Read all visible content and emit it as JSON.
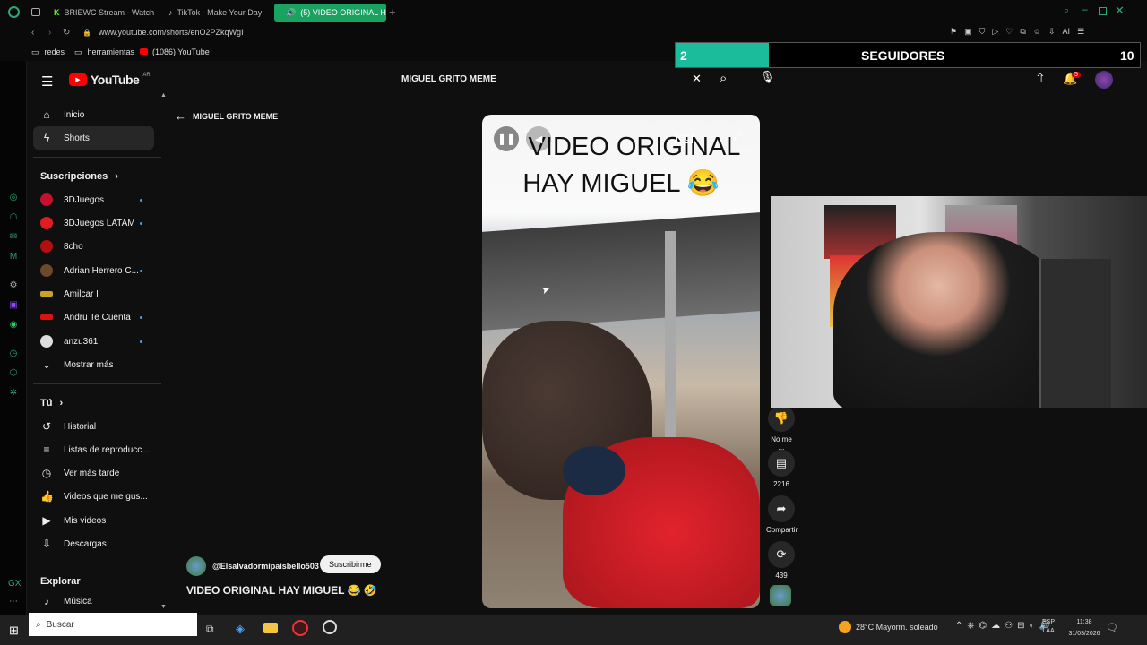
{
  "browser": {
    "tabs": [
      {
        "label": "BRIEWC Stream - Watch L"
      },
      {
        "label": "TikTok - Make Your Day"
      },
      {
        "label": "(5) VIDEO ORIGINAL H"
      }
    ],
    "url": "www.youtube.com/shorts/enO2PZkqWgI",
    "bookmarks": [
      "redes",
      "herramientas",
      "(1086) YouTube"
    ],
    "ai_label": "AI"
  },
  "youtube": {
    "logo_text": "YouTube",
    "country": "AR",
    "search_value": "MIGUEL GRITO MEME",
    "back_label": "MIGUEL GRITO MEME",
    "notifications_count": "5",
    "nav": [
      {
        "label": "Inicio",
        "icon": "home-icon"
      },
      {
        "label": "Shorts",
        "icon": "shorts-icon"
      }
    ],
    "subscriptions_title": "Suscripciones",
    "subscriptions": [
      {
        "label": "3DJuegos",
        "color": "#c8102e"
      },
      {
        "label": "3DJuegos LATAM",
        "color": "#e01b24"
      },
      {
        "label": "8cho",
        "color": "#b01010"
      },
      {
        "label": "Adrian Herrero C...",
        "color": "#6b4a2a"
      },
      {
        "label": "Amilcar I",
        "color": "#c9a227"
      },
      {
        "label": "Andru Te Cuenta",
        "color": "#d11"
      },
      {
        "label": "anzu361",
        "color": "#ddd"
      }
    ],
    "show_more": "Mostrar más",
    "you_title": "Tú",
    "you_items": [
      {
        "label": "Historial",
        "icon": "history-icon"
      },
      {
        "label": "Listas de reproducc...",
        "icon": "playlist-icon"
      },
      {
        "label": "Ver más tarde",
        "icon": "clock-icon"
      },
      {
        "label": "Videos que me gus...",
        "icon": "thumb-up-icon"
      },
      {
        "label": "Mis videos",
        "icon": "my-videos-icon"
      },
      {
        "label": "Descargas",
        "icon": "download-icon"
      }
    ],
    "explore_title": "Explorar",
    "explore_items": [
      {
        "label": "Música",
        "icon": "music-icon"
      }
    ],
    "short": {
      "overlay_line1": "VIDEO ORIGINAL",
      "overlay_line2": "HAY MIGUEL 😂",
      "channel": "@Elsalvadormipaisbello503",
      "subscribe": "Suscribirme",
      "title": "VIDEO ORIGINAL HAY MIGUEL 😂 🤣"
    },
    "actions": [
      {
        "label": "No me ...",
        "icon": "thumb-down-icon"
      },
      {
        "label": "2216",
        "icon": "comment-icon"
      },
      {
        "label": "Compartir",
        "icon": "share-icon"
      },
      {
        "label": "439",
        "icon": "remix-icon"
      }
    ]
  },
  "stream_overlay": {
    "left_value": "2",
    "label": "SEGUIDORES",
    "right_value": "10",
    "progress_color": "#1abc9c"
  },
  "taskbar": {
    "search_placeholder": "Buscar",
    "weather": "28°C  Mayorm. soleado",
    "lang_top": "ESP",
    "lang_bottom": "LAA",
    "time": "11:38",
    "date": "31/03/2026"
  }
}
